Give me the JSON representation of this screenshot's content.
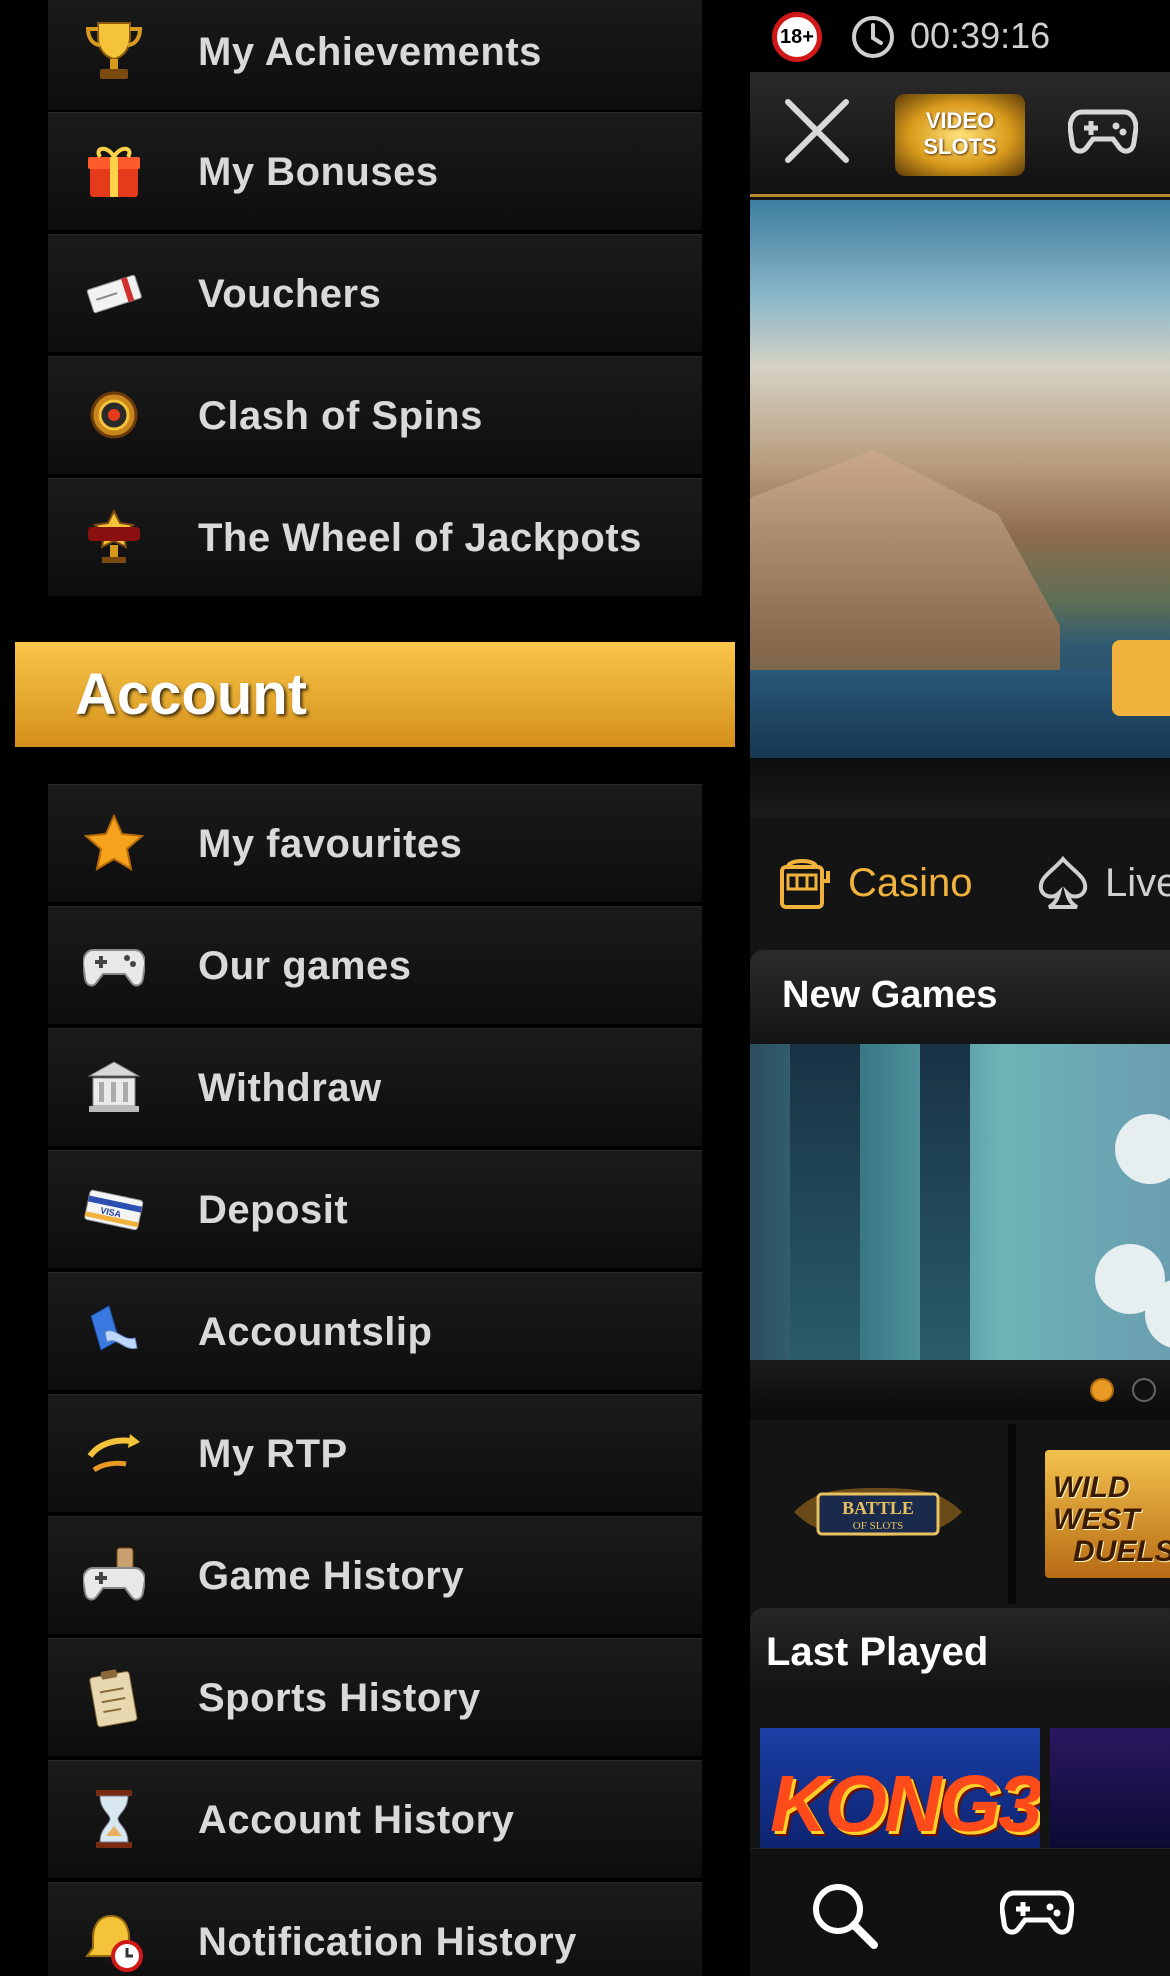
{
  "drawer": {
    "top_items": [
      {
        "label": "My Achievements",
        "icon": "trophy-icon"
      },
      {
        "label": "My Bonuses",
        "icon": "gift-icon"
      },
      {
        "label": "Vouchers",
        "icon": "voucher-icon"
      },
      {
        "label": "Clash of Spins",
        "icon": "clash-of-spins-icon"
      },
      {
        "label": "The Wheel of Jackpots",
        "icon": "jackpots-wheel-icon"
      }
    ],
    "section_title": "Account",
    "account_items": [
      {
        "label": "My favourites",
        "icon": "star-icon"
      },
      {
        "label": "Our games",
        "icon": "gamepad-icon"
      },
      {
        "label": "Withdraw",
        "icon": "bank-icon"
      },
      {
        "label": "Deposit",
        "icon": "credit-card-icon"
      },
      {
        "label": "Accountslip",
        "icon": "account-slip-icon"
      },
      {
        "label": "My RTP",
        "icon": "rtp-icon"
      },
      {
        "label": "Game History",
        "icon": "game-history-icon"
      },
      {
        "label": "Sports History",
        "icon": "clipboard-icon"
      },
      {
        "label": "Account History",
        "icon": "hourglass-icon"
      },
      {
        "label": "Notification History",
        "icon": "bell-clock-icon"
      }
    ]
  },
  "status_bar": {
    "age_badge": "18+",
    "timer": "00:39:16"
  },
  "header": {
    "logo_text": "VIDEO SLOTS"
  },
  "tabs": {
    "casino": "Casino",
    "live": "Live"
  },
  "sections": {
    "new_games": "New Games",
    "last_played": "Last Played"
  },
  "promos": {
    "battle_of_slots": "BATTLE OF SLOTS",
    "wild_west_duels": "WILD WEST DUELS"
  },
  "last_played": {
    "first_game": "KONG3"
  },
  "colors": {
    "accent": "#f0b23c",
    "account_header_top": "#f9c64a",
    "account_header_bottom": "#d4901a",
    "menu_bg": "#141414",
    "age_badge_ring": "#d01818"
  }
}
